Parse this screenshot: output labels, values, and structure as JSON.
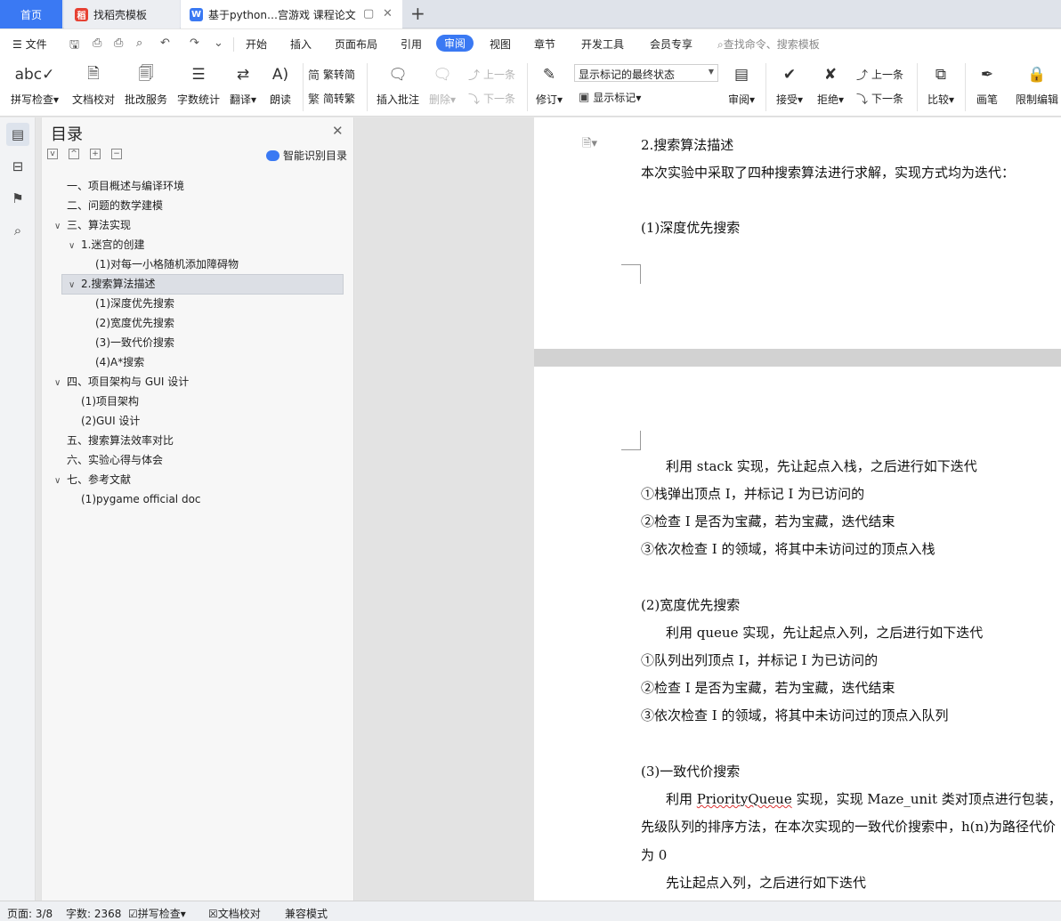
{
  "tabs": {
    "home": "首页",
    "template": "找稻壳模板",
    "document": "基于python…宫游戏 课程论文"
  },
  "menu": {
    "file": "文件",
    "items": [
      "开始",
      "插入",
      "页面布局",
      "引用",
      "审阅",
      "视图",
      "章节",
      "开发工具",
      "会员专享"
    ],
    "active": "审阅",
    "search_placeholder": "查找命令、搜索模板"
  },
  "ribbon": {
    "spell_check": "拼写检查",
    "doc_proof": "文档校对",
    "review_service": "批改服务",
    "word_count": "字数统计",
    "translate": "翻译",
    "read_aloud": "朗读",
    "trad_to_simp": "繁转简",
    "simp_to_trad": "简转繁",
    "insert_comment": "插入批注",
    "delete": "删除",
    "prev_comment": "上一条",
    "next_comment": "下一条",
    "track_changes": "修订",
    "markup_state": "显示标记的最终状态",
    "show_markup": "显示标记",
    "review_pane": "审阅",
    "accept": "接受",
    "reject": "拒绝",
    "prev_change": "上一条",
    "next_change": "下一条",
    "compare": "比较",
    "ink": "画笔",
    "restrict_edit": "限制编辑"
  },
  "toc": {
    "title": "目录",
    "smart_toc": "智能识别目录",
    "items": [
      {
        "label": "一、项目概述与编译环境",
        "level": 0,
        "caret": ""
      },
      {
        "label": "二、问题的数学建模",
        "level": 0,
        "caret": ""
      },
      {
        "label": "三、算法实现",
        "level": 0,
        "caret": "v"
      },
      {
        "label": "1.迷宫的创建",
        "level": 1,
        "caret": "v"
      },
      {
        "label": "(1)对每一小格随机添加障碍物",
        "level": 2,
        "caret": ""
      },
      {
        "label": "2.搜索算法描述",
        "level": 1,
        "caret": "v"
      },
      {
        "label": "(1)深度优先搜索",
        "level": 2,
        "caret": ""
      },
      {
        "label": "(2)宽度优先搜索",
        "level": 2,
        "caret": ""
      },
      {
        "label": "(3)一致代价搜索",
        "level": 2,
        "caret": ""
      },
      {
        "label": "(4)A*搜索",
        "level": 2,
        "caret": ""
      },
      {
        "label": "四、项目架构与 GUI 设计",
        "level": 0,
        "caret": "v"
      },
      {
        "label": "(1)项目架构",
        "level": 1,
        "caret": ""
      },
      {
        "label": "(2)GUI 设计",
        "level": 1,
        "caret": ""
      },
      {
        "label": "五、搜索算法效率对比",
        "level": 0,
        "caret": ""
      },
      {
        "label": "六、实验心得与体会",
        "level": 0,
        "caret": ""
      },
      {
        "label": "七、参考文献",
        "level": 0,
        "caret": "v"
      },
      {
        "label": "(1)pygame official doc",
        "level": 1,
        "caret": ""
      }
    ]
  },
  "document": {
    "page1": [
      "2.搜索算法描述",
      "本次实验中采取了四种搜索算法进行求解，实现方式均为迭代：",
      "(1)深度优先搜索"
    ],
    "page2": {
      "dfs_intro": "利用 stack 实现，先让起点入栈，之后进行如下迭代",
      "dfs_step1": "①栈弹出顶点 I，并标记 I 为已访问的",
      "dfs_step2": "②检查 I 是否为宝藏，若为宝藏，迭代结束",
      "dfs_step3": "③依次检查 I 的领域，将其中未访问过的顶点入栈",
      "bfs_title": "(2)宽度优先搜索",
      "bfs_intro": "利用 queue 实现，先让起点入列，之后进行如下迭代",
      "bfs_step1": "①队列出列顶点 I，并标记 I 为已访问的",
      "bfs_step2": "②检查 I 是否为宝藏，若为宝藏，迭代结束",
      "bfs_step3": "③依次检查 I 的领域，将其中未访问过的顶点入队列",
      "ucs_title": "(3)一致代价搜索",
      "ucs_intro_a": "利用 ",
      "ucs_intro_pq": "PriorityQueue",
      "ucs_intro_b": " 实现，实现 Maze_unit 类对顶点进行包装，并",
      "ucs_line2": "先级队列的排序方法，在本次实现的一致代价搜索中，h(n)为路径代价",
      "ucs_line3": "为 0",
      "ucs_line4": "先让起点入列，之后进行如下迭代"
    }
  },
  "status": {
    "page": "页面: 3/8",
    "words": "字数: 2368",
    "spell": "拼写检查",
    "proof": "文档校对",
    "compat": "兼容模式"
  },
  "colors": {
    "accent": "#3a79f3",
    "wps_red": "#e64032"
  }
}
